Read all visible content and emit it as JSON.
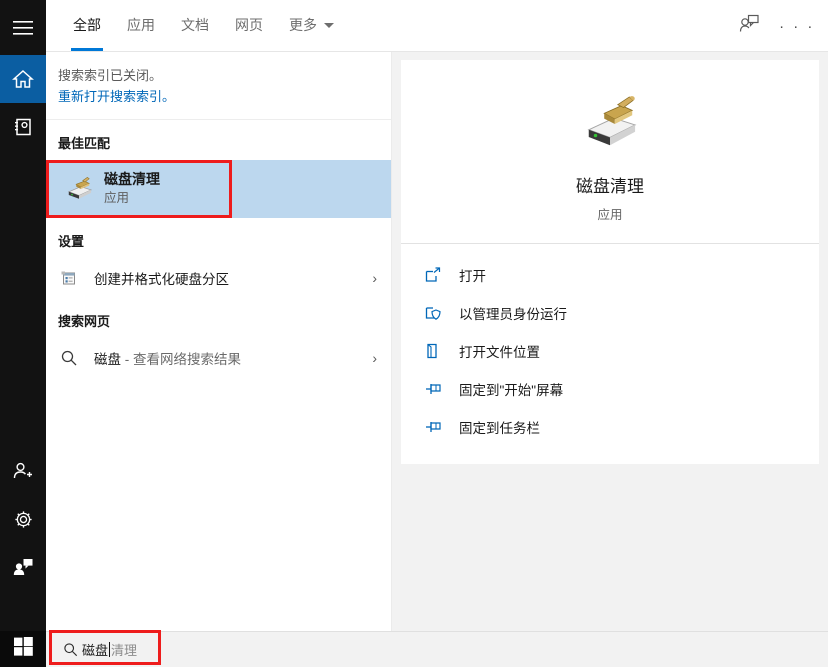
{
  "rail": {
    "items": [
      {
        "name": "hamburger",
        "icon": "hamburger-icon"
      },
      {
        "name": "home",
        "icon": "home-icon",
        "active": true
      },
      {
        "name": "notebook",
        "icon": "notebook-icon"
      }
    ],
    "bottom_items": [
      {
        "name": "account",
        "icon": "person-add-icon"
      },
      {
        "name": "settings",
        "icon": "gear-icon"
      },
      {
        "name": "feedback",
        "icon": "feedback-icon"
      }
    ]
  },
  "header": {
    "tabs": [
      {
        "label": "全部",
        "selected": true
      },
      {
        "label": "应用",
        "selected": false
      },
      {
        "label": "文档",
        "selected": false
      },
      {
        "label": "网页",
        "selected": false
      },
      {
        "label": "更多",
        "selected": false,
        "has_caret": true
      }
    ],
    "account_icon": "person-feedback-icon",
    "overflow_label": "· · ·"
  },
  "notice": {
    "message": "搜索索引已关闭。",
    "link": "重新打开搜索索引。"
  },
  "best_match": {
    "heading": "最佳匹配",
    "title": "磁盘清理",
    "subtitle": "应用",
    "icon": "disk-cleanup-icon",
    "highlight_color": "#bcd7ee",
    "annotation_color": "#ee1c1c"
  },
  "settings_section": {
    "heading": "设置",
    "items": [
      {
        "label": "创建并格式化硬盘分区",
        "icon": "control-panel-icon",
        "chevron": "›"
      }
    ]
  },
  "web_section": {
    "heading": "搜索网页",
    "items": [
      {
        "query": "磁盘",
        "suffix": " - 查看网络搜索结果",
        "icon": "search-icon",
        "chevron": "›"
      }
    ]
  },
  "preview": {
    "title": "磁盘清理",
    "subtitle": "应用",
    "icon": "disk-cleanup-icon",
    "actions": [
      {
        "label": "打开",
        "icon": "open-external-icon"
      },
      {
        "label": "以管理员身份运行",
        "icon": "shield-run-icon"
      },
      {
        "label": "打开文件位置",
        "icon": "folder-location-icon"
      },
      {
        "label": "固定到\"开始\"屏幕",
        "icon": "pin-icon"
      },
      {
        "label": "固定到任务栏",
        "icon": "pin-icon"
      }
    ]
  },
  "search": {
    "typed_text": "磁盘",
    "suggestion_text": "清理",
    "icon": "search-icon",
    "annotation_color": "#ee1c1c"
  },
  "taskbar": {
    "items": [
      {
        "name": "start-button",
        "icon": "windows-logo-icon"
      },
      {
        "name": "cortana-button",
        "icon": "cortana-circle-icon",
        "highlighted": true
      },
      {
        "name": "task-view-button",
        "icon": "task-view-icon"
      },
      {
        "name": "search-magnifier-button",
        "icon": "search-magnifier-icon"
      },
      {
        "name": "photoshop-button",
        "icon": "photoshop-icon"
      },
      {
        "name": "cloud-app-button",
        "icon": "blue-cloud-icon"
      },
      {
        "name": "chrome-button",
        "icon": "chrome-icon"
      },
      {
        "name": "green-browser-button",
        "icon": "green-browser-icon"
      },
      {
        "name": "file-explorer-button",
        "icon": "folder-icon"
      },
      {
        "name": "notepad-button",
        "icon": "notepad-icon"
      },
      {
        "name": "excel-button",
        "icon": "excel-icon"
      },
      {
        "name": "word-button",
        "icon": "word-icon"
      },
      {
        "name": "disk-cleanup-taskbar-button",
        "icon": "disk-cleanup-icon"
      }
    ]
  }
}
